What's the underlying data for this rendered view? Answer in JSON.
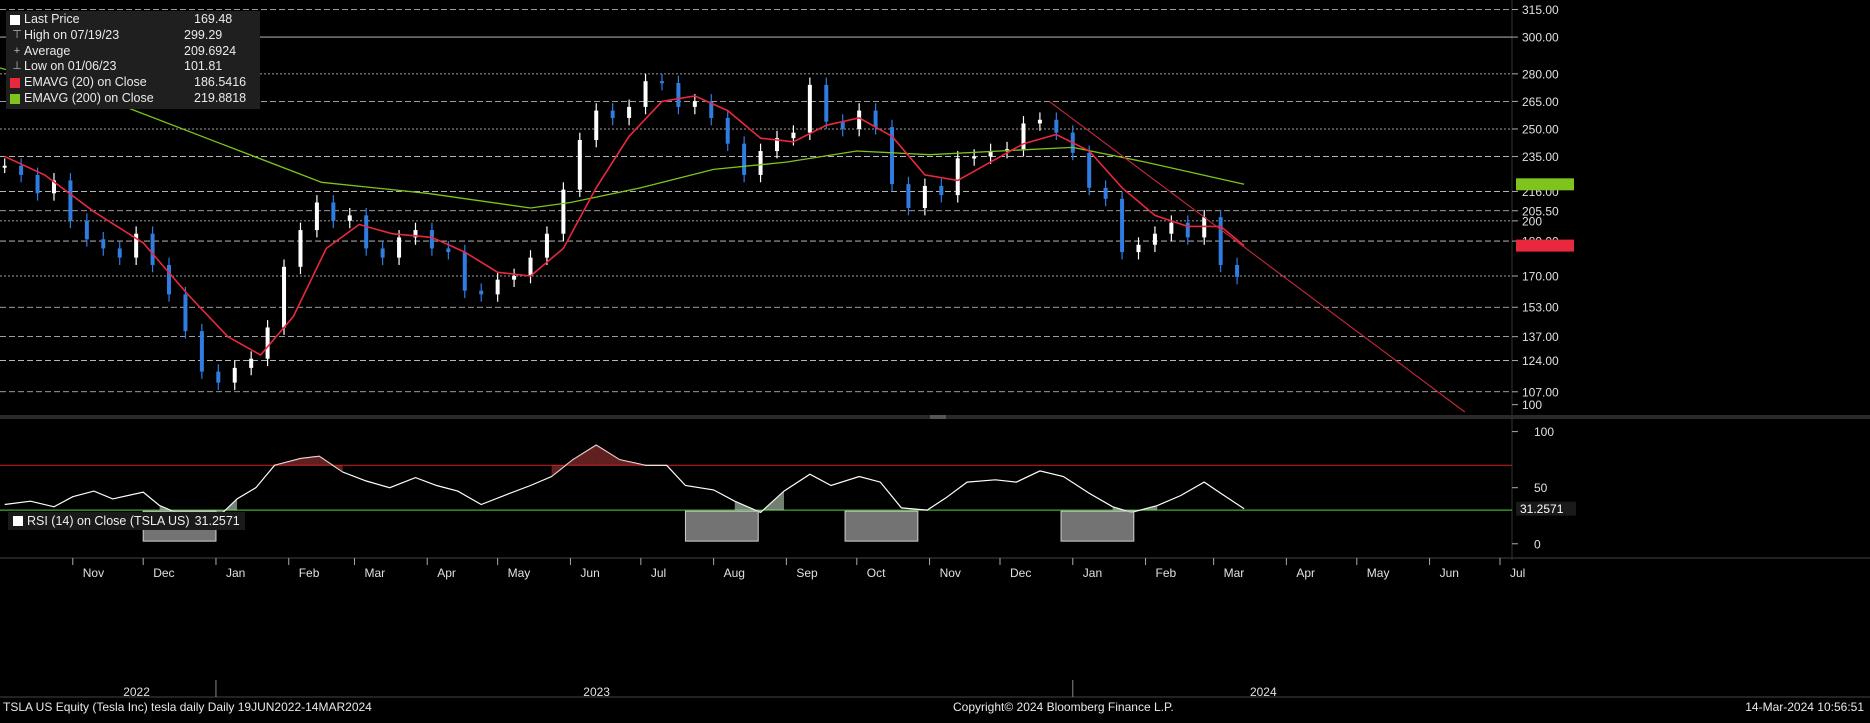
{
  "legend": {
    "items": [
      {
        "label": "Last Price",
        "value": "169.48",
        "color": "#ffffff",
        "kind": "square"
      },
      {
        "label": "High on 07/19/23",
        "value": "299.29",
        "color": "#bbbbbb",
        "kind": "marker"
      },
      {
        "label": "Average",
        "value": "209.6924",
        "color": "#bbbbbb",
        "kind": "marker"
      },
      {
        "label": "Low on 01/06/23",
        "value": "101.81",
        "color": "#bbbbbb",
        "kind": "marker"
      },
      {
        "label": "EMAVG (20)  on Close",
        "value": "186.5416",
        "color": "#e8283c",
        "kind": "square"
      },
      {
        "label": "EMAVG (200)  on Close",
        "value": "219.8818",
        "color": "#7fc41c",
        "kind": "square"
      }
    ]
  },
  "rsi_legend": {
    "label": "RSI (14)  on Close (TSLA US)",
    "value": "31.2571"
  },
  "footer": {
    "left": "TSLA US Equity (Tesla Inc) tesla daily  Daily 19JUN2022-14MAR2024",
    "center": "Copyright© 2024 Bloomberg Finance L.P.",
    "right": "14-Mar-2024 10:56:51"
  },
  "colors": {
    "background": "#000000",
    "up_bar": "#ffffff",
    "down_bar": "#2f7de1",
    "ema20": "#e8283c",
    "ema200": "#7fc41c",
    "trendline": "#c8283c",
    "rsi_line": "#ffffff",
    "rsi_upper": "#d02020",
    "rsi_lower": "#3fae2a"
  },
  "chart_data": [
    {
      "type": "line",
      "title": "TSLA US Equity (Tesla Inc) tesla daily",
      "y_ticks": [
        "315.00",
        "300.00",
        "280.00",
        "265.00",
        "250.00",
        "235.00",
        "216.00",
        "205.50",
        "200",
        "189.00",
        "170.00",
        "153.00",
        "137.00",
        "124.00",
        "107.00",
        "100"
      ],
      "ylim": [
        96,
        318
      ],
      "x_month_ticks": [
        "Nov",
        "Dec",
        "Jan",
        "Feb",
        "Mar",
        "Apr",
        "May",
        "Jun",
        "Jul",
        "Aug",
        "Sep",
        "Oct",
        "Nov",
        "Dec",
        "Jan",
        "Feb",
        "Mar",
        "Apr",
        "May",
        "Jun",
        "Jul"
      ],
      "x_year_labels": [
        "2022",
        "2023",
        "2024"
      ],
      "series": [
        {
          "name": "Last Price",
          "points": [
            [
              "2022-10-03",
              230
            ],
            [
              "2022-10-10",
              225
            ],
            [
              "2022-10-17",
              215
            ],
            [
              "2022-10-24",
              222
            ],
            [
              "2022-10-31",
              200
            ],
            [
              "2022-11-07",
              190
            ],
            [
              "2022-11-14",
              185
            ],
            [
              "2022-11-21",
              180
            ],
            [
              "2022-11-28",
              193
            ],
            [
              "2022-12-05",
              176
            ],
            [
              "2022-12-12",
              160
            ],
            [
              "2022-12-19",
              140
            ],
            [
              "2022-12-26",
              118
            ],
            [
              "2023-01-02",
              112
            ],
            [
              "2023-01-09",
              120
            ],
            [
              "2023-01-16",
              125
            ],
            [
              "2023-01-23",
              142
            ],
            [
              "2023-01-30",
              175
            ],
            [
              "2023-02-06",
              195
            ],
            [
              "2023-02-13",
              210
            ],
            [
              "2023-02-20",
              200
            ],
            [
              "2023-02-27",
              203
            ],
            [
              "2023-03-06",
              185
            ],
            [
              "2023-03-13",
              180
            ],
            [
              "2023-03-20",
              191
            ],
            [
              "2023-03-27",
              195
            ],
            [
              "2023-04-03",
              185
            ],
            [
              "2023-04-10",
              183
            ],
            [
              "2023-04-17",
              162
            ],
            [
              "2023-04-24",
              160
            ],
            [
              "2023-05-01",
              168
            ],
            [
              "2023-05-08",
              170
            ],
            [
              "2023-05-15",
              180
            ],
            [
              "2023-05-22",
              193
            ],
            [
              "2023-05-29",
              217
            ],
            [
              "2023-06-05",
              244
            ],
            [
              "2023-06-12",
              260
            ],
            [
              "2023-06-19",
              256
            ],
            [
              "2023-06-26",
              262
            ],
            [
              "2023-07-03",
              276
            ],
            [
              "2023-07-10",
              275
            ],
            [
              "2023-07-17",
              262
            ],
            [
              "2023-07-24",
              265
            ],
            [
              "2023-07-31",
              256
            ],
            [
              "2023-08-07",
              242
            ],
            [
              "2023-08-14",
              225
            ],
            [
              "2023-08-21",
              238
            ],
            [
              "2023-08-28",
              245
            ],
            [
              "2023-09-04",
              248
            ],
            [
              "2023-09-11",
              274
            ],
            [
              "2023-09-18",
              254
            ],
            [
              "2023-09-25",
              250
            ],
            [
              "2023-10-02",
              260
            ],
            [
              "2023-10-09",
              251
            ],
            [
              "2023-10-16",
              220
            ],
            [
              "2023-10-23",
              207
            ],
            [
              "2023-10-30",
              219
            ],
            [
              "2023-11-06",
              214
            ],
            [
              "2023-11-13",
              234
            ],
            [
              "2023-11-20",
              235
            ],
            [
              "2023-11-27",
              238
            ],
            [
              "2023-12-04",
              239
            ],
            [
              "2023-12-11",
              253
            ],
            [
              "2023-12-18",
              255
            ],
            [
              "2023-12-25",
              248
            ],
            [
              "2024-01-01",
              237
            ],
            [
              "2024-01-08",
              218
            ],
            [
              "2024-01-15",
              212
            ],
            [
              "2024-01-22",
              183
            ],
            [
              "2024-01-29",
              187
            ],
            [
              "2024-02-05",
              193
            ],
            [
              "2024-02-12",
              199
            ],
            [
              "2024-02-19",
              191
            ],
            [
              "2024-02-26",
              202
            ],
            [
              "2024-03-04",
              176
            ],
            [
              "2024-03-11",
              169.48
            ]
          ]
        },
        {
          "name": "EMAVG (20)  on Close",
          "points": [
            [
              "2022-10-03",
              235
            ],
            [
              "2022-10-20",
              225
            ],
            [
              "2022-11-10",
              205
            ],
            [
              "2022-12-01",
              188
            ],
            [
              "2022-12-20",
              160
            ],
            [
              "2023-01-06",
              137
            ],
            [
              "2023-01-20",
              127
            ],
            [
              "2023-02-03",
              148
            ],
            [
              "2023-02-17",
              185
            ],
            [
              "2023-03-03",
              198
            ],
            [
              "2023-03-17",
              193
            ],
            [
              "2023-04-03",
              191
            ],
            [
              "2023-04-17",
              183
            ],
            [
              "2023-05-01",
              172
            ],
            [
              "2023-05-15",
              170
            ],
            [
              "2023-05-29",
              185
            ],
            [
              "2023-06-12",
              218
            ],
            [
              "2023-06-26",
              246
            ],
            [
              "2023-07-10",
              265
            ],
            [
              "2023-07-24",
              268
            ],
            [
              "2023-08-07",
              260
            ],
            [
              "2023-08-21",
              245
            ],
            [
              "2023-09-04",
              243
            ],
            [
              "2023-09-18",
              252
            ],
            [
              "2023-10-02",
              256
            ],
            [
              "2023-10-16",
              246
            ],
            [
              "2023-10-30",
              225
            ],
            [
              "2023-11-13",
              222
            ],
            [
              "2023-11-27",
              232
            ],
            [
              "2023-12-11",
              242
            ],
            [
              "2023-12-25",
              247
            ],
            [
              "2024-01-08",
              238
            ],
            [
              "2024-01-22",
              218
            ],
            [
              "2024-02-05",
              203
            ],
            [
              "2024-02-19",
              197
            ],
            [
              "2024-03-04",
              197
            ],
            [
              "2024-03-14",
              186.54
            ]
          ]
        },
        {
          "name": "EMAVG (200)  on Close",
          "points": [
            [
              "2022-09-01",
              293
            ],
            [
              "2022-11-01",
              273
            ],
            [
              "2023-01-01",
              243
            ],
            [
              "2023-02-15",
              221
            ],
            [
              "2023-04-01",
              215
            ],
            [
              "2023-05-15",
              207
            ],
            [
              "2023-06-01",
              210
            ],
            [
              "2023-07-01",
              218
            ],
            [
              "2023-08-01",
              228
            ],
            [
              "2023-09-01",
              232
            ],
            [
              "2023-10-01",
              238
            ],
            [
              "2023-11-01",
              236
            ],
            [
              "2023-12-01",
              238
            ],
            [
              "2024-01-01",
              240
            ],
            [
              "2024-02-01",
              232
            ],
            [
              "2024-03-14",
              219.88
            ]
          ]
        },
        {
          "name": "Trend line",
          "points": [
            [
              "2023-12-22",
              265
            ],
            [
              "2024-06-16",
              96
            ]
          ]
        }
      ]
    },
    {
      "type": "line",
      "title": "RSI (14)  on Close (TSLA US)",
      "y_ticks": [
        "100",
        "50",
        "0"
      ],
      "ylim": [
        -10,
        105
      ],
      "reference_lines": [
        70,
        30
      ],
      "last_value": 31.2571,
      "series": [
        {
          "name": "RSI (14)  on Close (TSLA US)",
          "points": [
            [
              "2022-10-03",
              35
            ],
            [
              "2022-10-14",
              38
            ],
            [
              "2022-10-24",
              33
            ],
            [
              "2022-11-01",
              42
            ],
            [
              "2022-11-10",
              47
            ],
            [
              "2022-11-18",
              40
            ],
            [
              "2022-12-01",
              46
            ],
            [
              "2022-12-08",
              34
            ],
            [
              "2022-12-16",
              27
            ],
            [
              "2022-12-23",
              22
            ],
            [
              "2023-01-03",
              26
            ],
            [
              "2023-01-10",
              40
            ],
            [
              "2023-01-18",
              50
            ],
            [
              "2023-01-26",
              70
            ],
            [
              "2023-02-06",
              76
            ],
            [
              "2023-02-14",
              78
            ],
            [
              "2023-02-24",
              64
            ],
            [
              "2023-03-06",
              56
            ],
            [
              "2023-03-16",
              50
            ],
            [
              "2023-03-27",
              59
            ],
            [
              "2023-04-05",
              52
            ],
            [
              "2023-04-14",
              47
            ],
            [
              "2023-04-24",
              35
            ],
            [
              "2023-05-05",
              44
            ],
            [
              "2023-05-15",
              52
            ],
            [
              "2023-05-24",
              60
            ],
            [
              "2023-06-02",
              75
            ],
            [
              "2023-06-12",
              88
            ],
            [
              "2023-06-22",
              75
            ],
            [
              "2023-07-03",
              70
            ],
            [
              "2023-07-12",
              70
            ],
            [
              "2023-07-20",
              52
            ],
            [
              "2023-08-01",
              48
            ],
            [
              "2023-08-10",
              38
            ],
            [
              "2023-08-21",
              28
            ],
            [
              "2023-08-31",
              47
            ],
            [
              "2023-09-11",
              62
            ],
            [
              "2023-09-20",
              52
            ],
            [
              "2023-10-02",
              60
            ],
            [
              "2023-10-11",
              55
            ],
            [
              "2023-10-20",
              32
            ],
            [
              "2023-10-31",
              30
            ],
            [
              "2023-11-08",
              41
            ],
            [
              "2023-11-17",
              55
            ],
            [
              "2023-11-29",
              57
            ],
            [
              "2023-12-08",
              55
            ],
            [
              "2023-12-18",
              65
            ],
            [
              "2023-12-28",
              60
            ],
            [
              "2024-01-08",
              45
            ],
            [
              "2024-01-18",
              33
            ],
            [
              "2024-01-26",
              28
            ],
            [
              "2024-02-06",
              34
            ],
            [
              "2024-02-16",
              43
            ],
            [
              "2024-02-26",
              55
            ],
            [
              "2024-03-04",
              45
            ],
            [
              "2024-03-14",
              31.2571
            ]
          ]
        }
      ]
    }
  ]
}
